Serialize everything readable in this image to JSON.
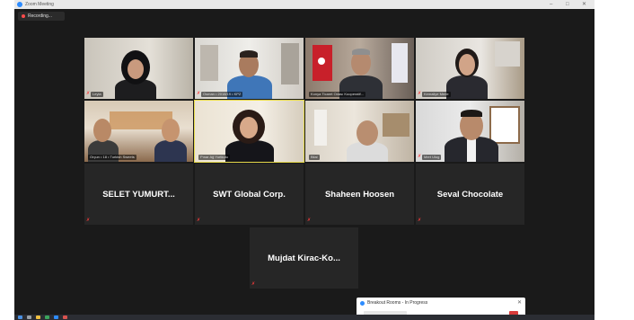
{
  "window": {
    "title": "Zoom Meeting",
    "controls": [
      "–",
      "□",
      "✕"
    ]
  },
  "recording": {
    "label": "Recording..."
  },
  "video_tiles": [
    {
      "name": "Leyla",
      "muted": true
    },
    {
      "name": "Osman • 2018/19 • KPZ",
      "muted": true
    },
    {
      "name": "Konya Ticaret Odası Kooperatif...",
      "muted": false
    },
    {
      "name": "Kemaliye Merle",
      "muted": true
    },
    {
      "name": "Orçun • 18 • Turkish Sweets",
      "muted": true
    },
    {
      "name": "Pınar Ağ Yurtkulu",
      "muted": false,
      "active": true
    },
    {
      "name": "Bilal",
      "muted": false
    },
    {
      "name": "Mert Ulug",
      "muted": true
    }
  ],
  "name_tiles": [
    {
      "name": "SELET  YUMURT...",
      "muted": true
    },
    {
      "name": "SWT Global Corp.",
      "muted": true
    },
    {
      "name": "Shaheen Hoosen",
      "muted": true
    },
    {
      "name": "Seval Chocolate",
      "muted": true
    },
    {
      "name": "Mujdat  Kirac-Ko...",
      "muted": true
    }
  ],
  "breakout_popup": {
    "title": "Breakout Rooms - In Progress",
    "close": "✕"
  },
  "colors": {
    "meeting_bg": "#1a1a1a",
    "tile_bg": "#262626",
    "active_border": "#e6d94a",
    "muted_red": "#ff3b3b",
    "zoom_blue": "#2d8cff"
  }
}
